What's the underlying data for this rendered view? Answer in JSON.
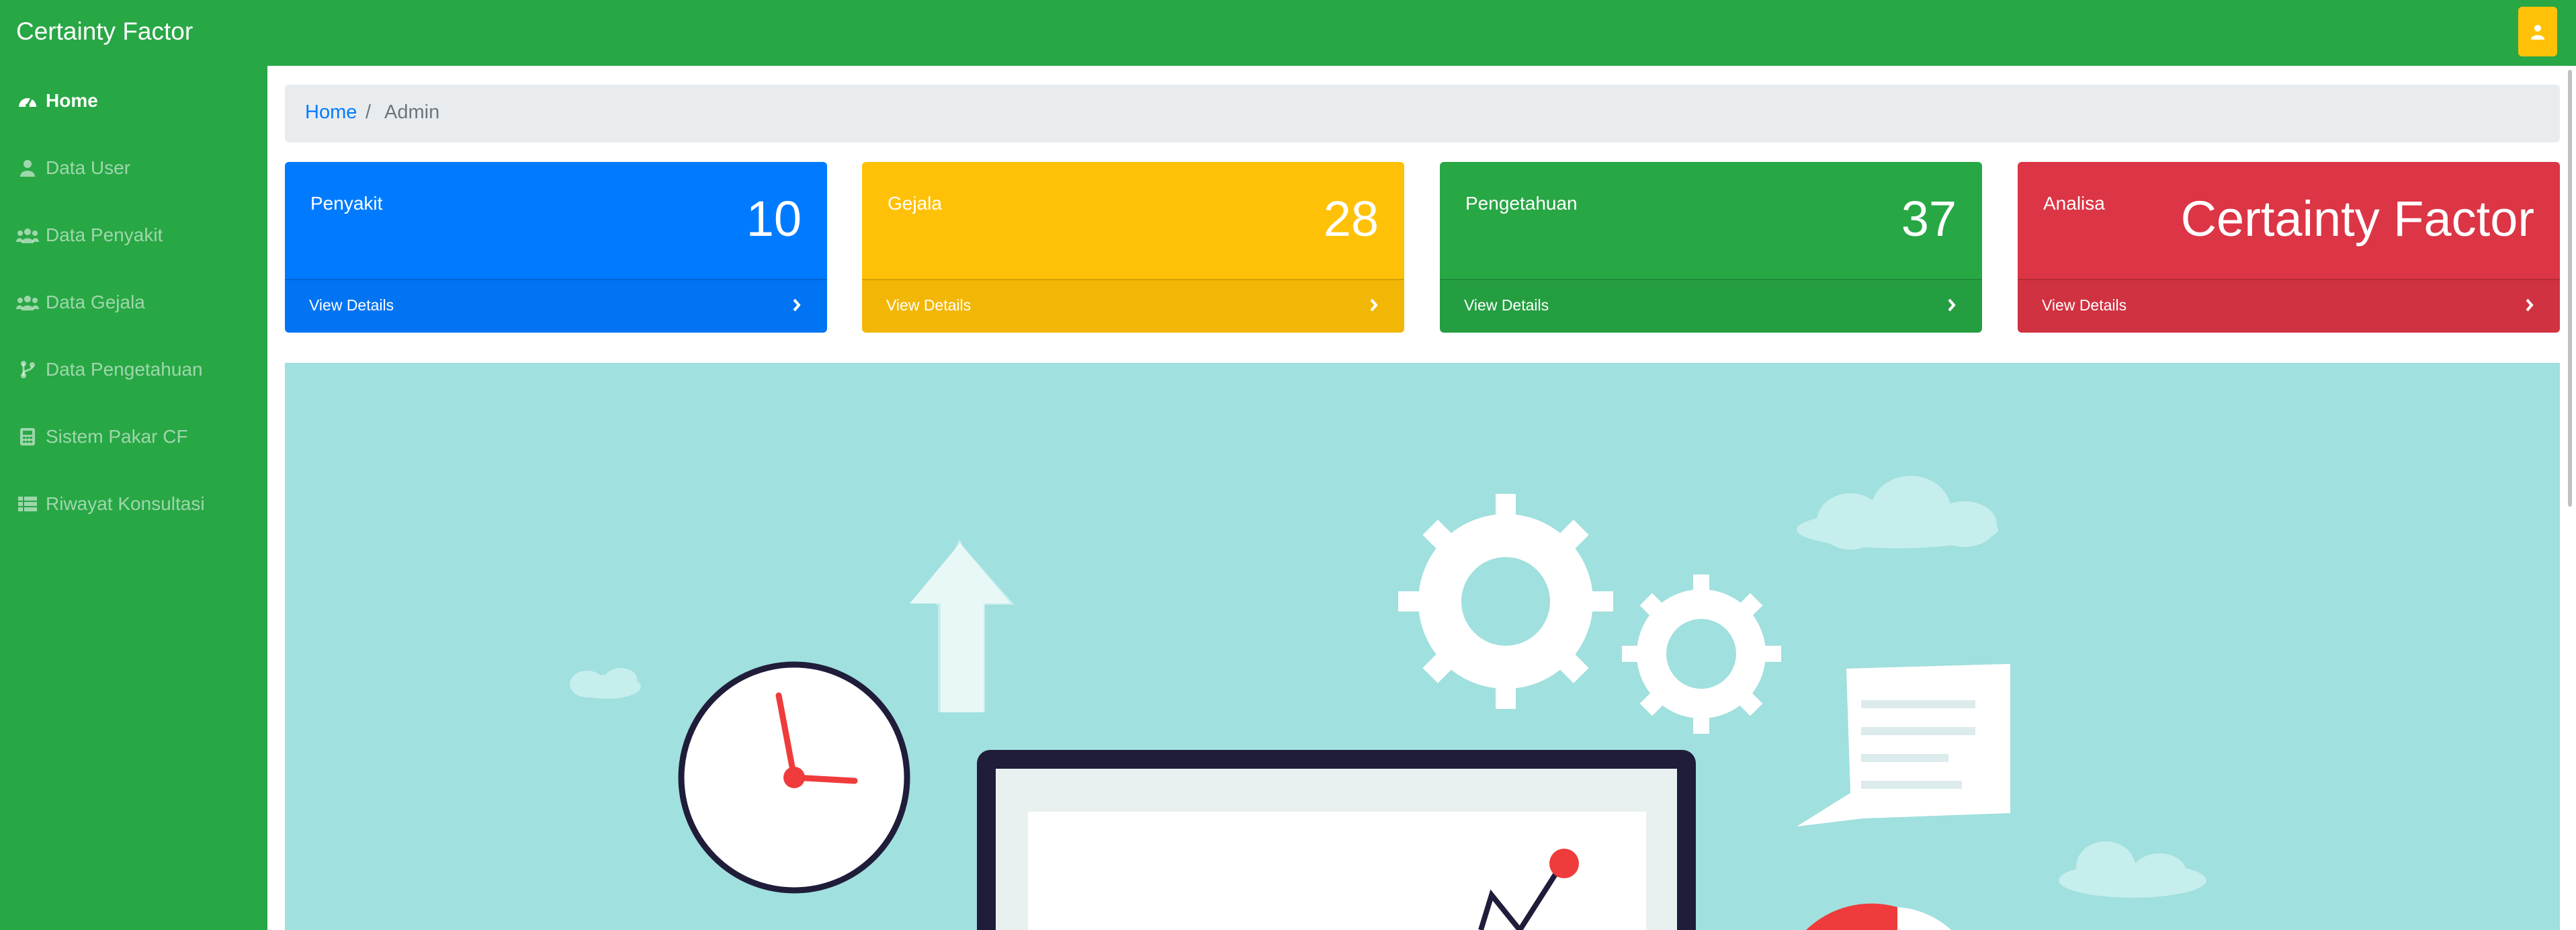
{
  "app": {
    "brand": "Certainty Factor"
  },
  "topbar": {
    "user_icon": "user-icon"
  },
  "sidebar": {
    "items": [
      {
        "label": "Home",
        "icon": "dashboard-icon",
        "active": true
      },
      {
        "label": "Data User",
        "icon": "user-icon",
        "active": false
      },
      {
        "label": "Data Penyakit",
        "icon": "users-icon",
        "active": false
      },
      {
        "label": "Data Gejala",
        "icon": "users-icon",
        "active": false
      },
      {
        "label": "Data Pengetahuan",
        "icon": "code-branch-icon",
        "active": false
      },
      {
        "label": "Sistem Pakar CF",
        "icon": "calculator-icon",
        "active": false
      },
      {
        "label": "Riwayat Konsultasi",
        "icon": "list-icon",
        "active": false
      }
    ]
  },
  "breadcrumb": {
    "home": "Home",
    "separator": "/",
    "current": "Admin"
  },
  "cards": [
    {
      "label": "Penyakit",
      "value": "10",
      "footer": "View Details",
      "color": "#007bff"
    },
    {
      "label": "Gejala",
      "value": "28",
      "footer": "View Details",
      "color": "#ffc107"
    },
    {
      "label": "Pengetahuan",
      "value": "37",
      "footer": "View Details",
      "color": "#28a745"
    },
    {
      "label": "Analisa",
      "value": "Certainty Factor",
      "footer": "View Details",
      "color": "#dc3545"
    }
  ],
  "colors": {
    "sidebar": "#28a745",
    "breadcrumb_bg": "#e9ecef",
    "hero_bg": "#a0e0de",
    "link": "#007bff"
  }
}
